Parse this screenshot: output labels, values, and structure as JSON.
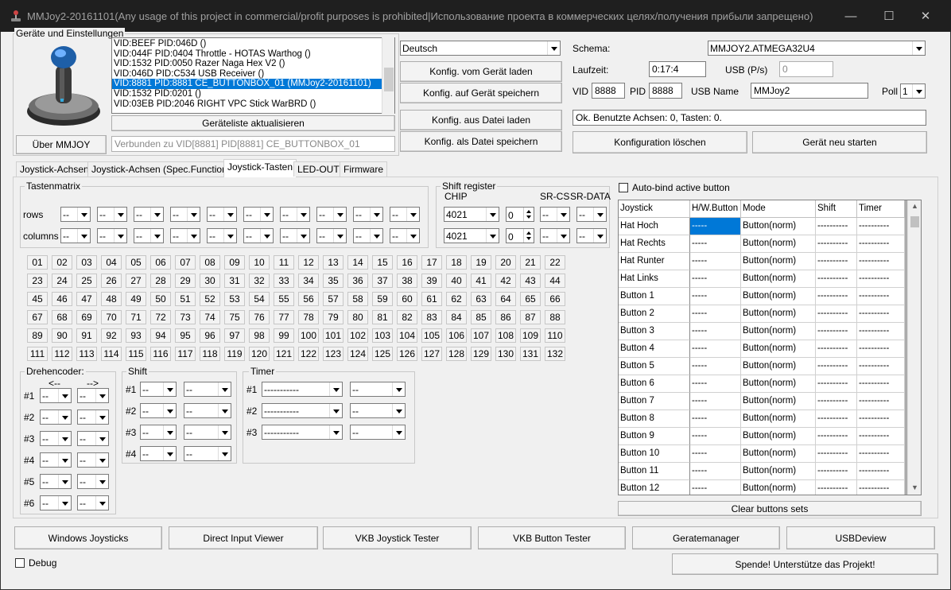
{
  "window": {
    "title": "MMJoy2-20161101(Any usage of this project in commercial/profit purposes is prohibited|Использование проекта в коммерческих целях/получения прибыли запрещено)",
    "minimize": "—",
    "maximize": "☐",
    "close": "✕"
  },
  "devices": {
    "group_label": "Geräte und Einstellungen",
    "list": [
      "VID:BEEF PID:046D  ()",
      "VID:044F PID:0404 Throttle - HOTAS Warthog ()",
      "VID:1532 PID:0050 Razer Naga Hex V2 ()",
      "VID:046D PID:C534 USB Receiver ()",
      "VID:8881 PID:8881 CE_BUTTONBOX_01 (MMJoy2-20161101)",
      "VID:1532 PID:0201  ()",
      "VID:03EB PID:2046 RIGHT VPC Stick WarBRD ()"
    ],
    "selected_index": 4,
    "refresh_button": "Geräteliste aktualisieren",
    "about_button": "Über MMJOY",
    "connected_text": "Verbunden zu VID[8881] PID[8881] CE_BUTTONBOX_01"
  },
  "config": {
    "language": "Deutsch",
    "load_device": "Konfig. vom Gerät laden",
    "save_device": "Konfig. auf Gerät speichern",
    "load_file": "Konfig. aus Datei laden",
    "save_file": "Konfig. als Datei speichern"
  },
  "scheme": {
    "label": "Schema:",
    "value": "MMJOY2.ATMEGA32U4",
    "runtime_label": "Laufzeit:",
    "runtime_value": "0:17:4",
    "usb_ps_label": "USB (P/s)",
    "usb_ps_value": "0",
    "vid_label": "VID",
    "vid_value": "8888",
    "pid_label": "PID",
    "pid_value": "8888",
    "usb_name_label": "USB Name",
    "usb_name_value": "MMJoy2",
    "poll_label": "Poll",
    "poll_value": "1",
    "status": "Ok. Benutzte Achsen:  0, Tasten: 0.",
    "delete_config": "Konfiguration löschen",
    "restart": "Gerät neu starten"
  },
  "tabs": [
    "Joystick-Achsen",
    "Joystick-Achsen (Spec.Functions)",
    "Joystick-Tasten",
    "LED-OUT",
    "Firmware"
  ],
  "active_tab": 2,
  "matrix": {
    "label": "Tastenmatrix",
    "rows_label": "rows",
    "columns_label": "columns",
    "dash": "--"
  },
  "shift_register": {
    "label": "Shift register",
    "chip_label": "CHIP",
    "srcs_label": "SR-CS",
    "srdata_label": "SR-DATA",
    "chip1": "4021",
    "chip2": "4021",
    "count1": "0",
    "count2": "0"
  },
  "buttons": [
    "01",
    "02",
    "03",
    "04",
    "05",
    "06",
    "07",
    "08",
    "09",
    "10",
    "11",
    "12",
    "13",
    "14",
    "15",
    "16",
    "17",
    "18",
    "19",
    "20",
    "21",
    "22",
    "23",
    "24",
    "25",
    "26",
    "27",
    "28",
    "29",
    "30",
    "31",
    "32",
    "33",
    "34",
    "35",
    "36",
    "37",
    "38",
    "39",
    "40",
    "41",
    "42",
    "43",
    "44",
    "45",
    "46",
    "47",
    "48",
    "49",
    "50",
    "51",
    "52",
    "53",
    "54",
    "55",
    "56",
    "57",
    "58",
    "59",
    "60",
    "61",
    "62",
    "63",
    "64",
    "65",
    "66",
    "67",
    "68",
    "69",
    "70",
    "71",
    "72",
    "73",
    "74",
    "75",
    "76",
    "77",
    "78",
    "79",
    "80",
    "81",
    "82",
    "83",
    "84",
    "85",
    "86",
    "87",
    "88",
    "89",
    "90",
    "91",
    "92",
    "93",
    "94",
    "95",
    "96",
    "97",
    "98",
    "99",
    "100",
    "101",
    "102",
    "103",
    "104",
    "105",
    "106",
    "107",
    "108",
    "109",
    "110",
    "111",
    "112",
    "113",
    "114",
    "115",
    "116",
    "117",
    "118",
    "119",
    "120",
    "121",
    "122",
    "123",
    "124",
    "125",
    "126",
    "127",
    "128",
    "129",
    "130",
    "131",
    "132"
  ],
  "encoder": {
    "label": "Drehencoder:",
    "left_label": "<--",
    "right_label": "-->",
    "rows": [
      "#1",
      "#2",
      "#3",
      "#4",
      "#5",
      "#6"
    ]
  },
  "shift": {
    "label": "Shift",
    "rows": [
      "#1",
      "#2",
      "#3",
      "#4"
    ]
  },
  "timer": {
    "label": "Timer",
    "rows": [
      "#1",
      "#2",
      "#3"
    ],
    "placeholder": "-----------"
  },
  "autobind": "Auto-bind active button",
  "grid": {
    "headers": [
      "Joystick",
      "H/W.Button",
      "Mode",
      "Shift",
      "Timer"
    ],
    "rows": [
      [
        "Hat Hoch",
        "-----",
        "Button(norm)",
        "----------",
        "----------"
      ],
      [
        "Hat Rechts",
        "-----",
        "Button(norm)",
        "----------",
        "----------"
      ],
      [
        "Hat Runter",
        "-----",
        "Button(norm)",
        "----------",
        "----------"
      ],
      [
        "Hat Links",
        "-----",
        "Button(norm)",
        "----------",
        "----------"
      ],
      [
        "Button 1",
        "-----",
        "Button(norm)",
        "----------",
        "----------"
      ],
      [
        "Button 2",
        "-----",
        "Button(norm)",
        "----------",
        "----------"
      ],
      [
        "Button 3",
        "-----",
        "Button(norm)",
        "----------",
        "----------"
      ],
      [
        "Button 4",
        "-----",
        "Button(norm)",
        "----------",
        "----------"
      ],
      [
        "Button 5",
        "-----",
        "Button(norm)",
        "----------",
        "----------"
      ],
      [
        "Button 6",
        "-----",
        "Button(norm)",
        "----------",
        "----------"
      ],
      [
        "Button 7",
        "-----",
        "Button(norm)",
        "----------",
        "----------"
      ],
      [
        "Button 8",
        "-----",
        "Button(norm)",
        "----------",
        "----------"
      ],
      [
        "Button 9",
        "-----",
        "Button(norm)",
        "----------",
        "----------"
      ],
      [
        "Button 10",
        "-----",
        "Button(norm)",
        "----------",
        "----------"
      ],
      [
        "Button 11",
        "-----",
        "Button(norm)",
        "----------",
        "----------"
      ],
      [
        "Button 12",
        "-----",
        "Button(norm)",
        "----------",
        "----------"
      ]
    ],
    "clear_button": "Clear buttons sets"
  },
  "bottom": {
    "windows_joysticks": "Windows Joysticks",
    "direct_input": "Direct Input Viewer",
    "vkb_joystick": "VKB Joystick Tester",
    "vkb_button": "VKB Button Tester",
    "geratemanager": "Geratemanager",
    "usbdeview": "USBDeview",
    "debug": "Debug",
    "donate": "Spende! Unterstütze das Projekt!"
  }
}
